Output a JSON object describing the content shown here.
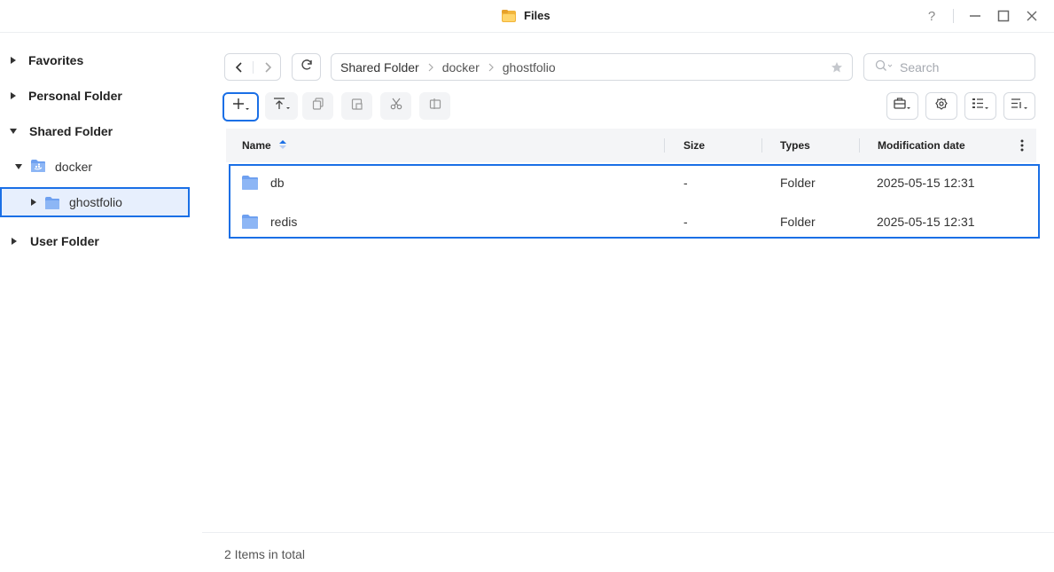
{
  "window": {
    "title": "Files"
  },
  "sidebar": {
    "items": [
      {
        "label": "Favorites"
      },
      {
        "label": "Personal Folder"
      },
      {
        "label": "Shared Folder"
      },
      {
        "label": "docker"
      },
      {
        "label": "ghostfolio"
      },
      {
        "label": "User Folder"
      }
    ]
  },
  "path": {
    "crumbs": [
      "Shared Folder",
      "docker",
      "ghostfolio"
    ]
  },
  "search": {
    "placeholder": "Search"
  },
  "table": {
    "columns": [
      "Name",
      "Size",
      "Types",
      "Modification date"
    ],
    "sort": {
      "column": "Name",
      "direction": "ascending"
    },
    "rows": [
      {
        "name": "db",
        "size": "-",
        "type": "Folder",
        "modified": "2025-05-15 12:31"
      },
      {
        "name": "redis",
        "size": "-",
        "type": "Folder",
        "modified": "2025-05-15 12:31"
      }
    ]
  },
  "footer": {
    "status": "2 Items in total"
  },
  "icons": {
    "app": "folder-app-icon",
    "help": "question-icon",
    "minimize": "minimize-icon",
    "maximize": "maximize-icon",
    "close": "close-icon",
    "back": "chevron-left-icon",
    "forward": "chevron-right-icon",
    "refresh": "refresh-icon",
    "favorite": "star-icon",
    "search": "search-icon",
    "create": "plus-icon",
    "upload": "upload-icon",
    "copy": "copy-icon",
    "paste": "paste-icon",
    "cut": "scissors-icon",
    "rename": "rename-icon",
    "tools": "toolbox-icon",
    "settings": "gear-icon",
    "view": "list-view-icon",
    "sort": "sort-icon",
    "more": "more-vertical-icon",
    "folder": "folder-icon"
  },
  "colors": {
    "accent": "#1a6fe6",
    "folder": "#6ea0f0",
    "selected_bg": "#e7effd"
  }
}
